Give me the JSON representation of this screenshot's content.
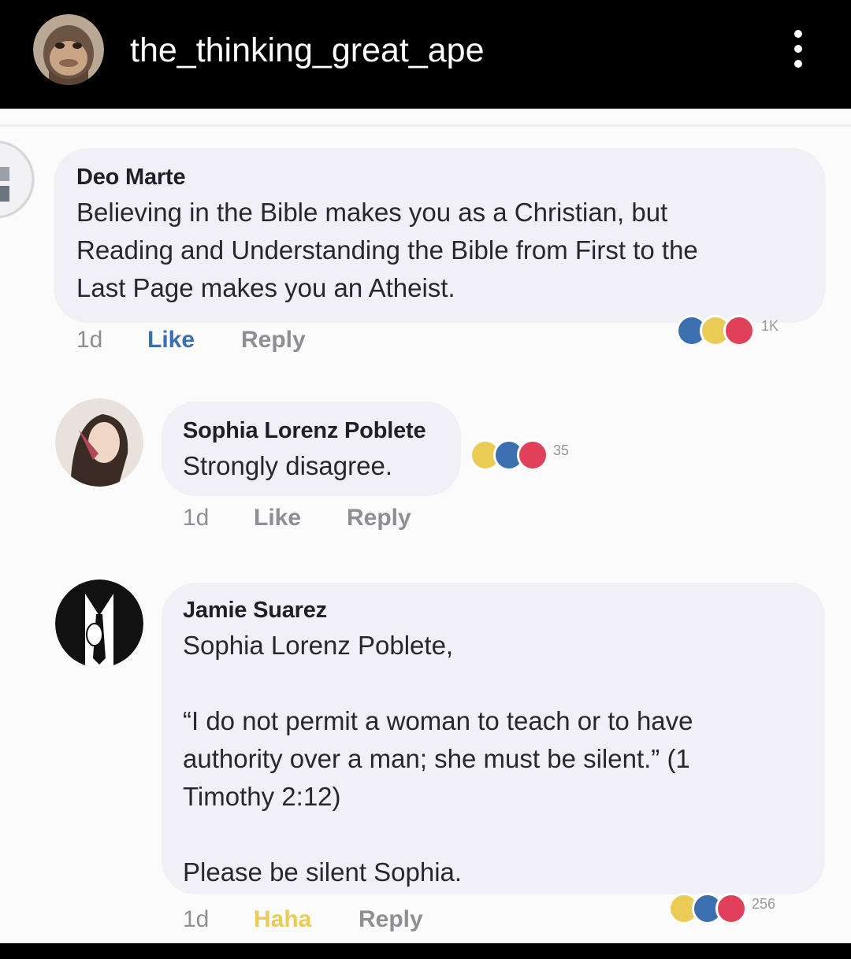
{
  "profile": {
    "username": "the_thinking_great_ape",
    "avatar_icon": "ape-avatar-icon",
    "menu_icon": "more-options-icon"
  },
  "colors": {
    "header_bg": "#000000",
    "post_bg": "#fbfbfc",
    "bubble_bg": "#f1f0f6",
    "like_blue": "#3b6fb0",
    "haha_yellow": "#e9cb56",
    "love_red": "#e0405a"
  },
  "comments": [
    {
      "author": "Deo Marte",
      "text": "Believing in the Bible makes you as a Christian, but\nReading and Understanding the Bible from First to the\nLast Page makes you an Atheist.",
      "time": "1d",
      "like_label": "Like",
      "reply_label": "Reply",
      "reaction_icons": [
        "like-icon",
        "haha-icon",
        "love-icon"
      ],
      "reaction_count": "1K"
    },
    {
      "author": "Sophia Lorenz Poblete",
      "text": "Strongly disagree.",
      "time": "1d",
      "like_label": "Like",
      "reply_label": "Reply",
      "reaction_icons": [
        "haha-icon",
        "like-icon",
        "love-icon"
      ],
      "reaction_count": "35"
    },
    {
      "author": "Jamie Suarez",
      "text": "Sophia Lorenz Poblete,\n\n“I do not permit a woman to teach or to have\nauthority over a man; she must be silent.” (1\nTimothy 2:12)\n\nPlease be silent Sophia.",
      "time": "1d",
      "like_label": "Haha",
      "reply_label": "Reply",
      "reaction_icons": [
        "haha-icon",
        "like-icon",
        "love-icon"
      ],
      "reaction_count": "256"
    }
  ]
}
